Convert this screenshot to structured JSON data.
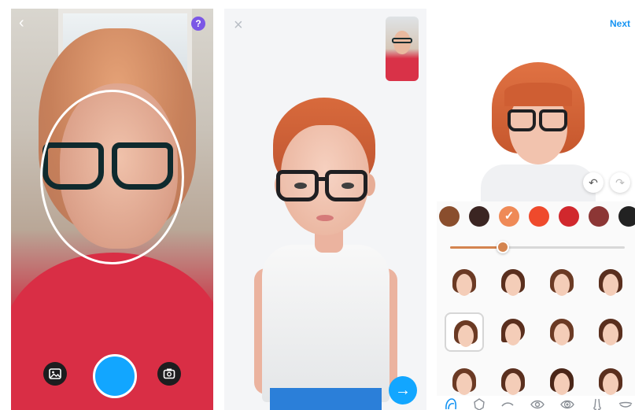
{
  "camera": {
    "back_icon": "chevron-left-icon",
    "help_label": "?",
    "gallery_icon": "gallery-icon",
    "capture_button": "capture-button",
    "flip_icon": "camera-flip-icon"
  },
  "avatar_preview": {
    "close_icon": "close-icon",
    "thumbnail": "photo-thumbnail",
    "next_arrow_label": "→"
  },
  "editor": {
    "next_label": "Next",
    "undo_icon": "undo-icon",
    "redo_icon": "redo-icon",
    "colors": [
      {
        "hex": "#8a4e2d"
      },
      {
        "hex": "#3b2522"
      },
      {
        "hex": "#ef8a57",
        "selected": true
      },
      {
        "hex": "#ef4a2c"
      },
      {
        "hex": "#d1282d"
      },
      {
        "hex": "#8c3635"
      },
      {
        "hex": "#222222"
      }
    ],
    "check_mark": "✓",
    "slider": {
      "value": 0.3
    },
    "tabs": [
      "hair-icon",
      "face-shape-icon",
      "eyebrow-icon",
      "eye-icon",
      "eye-color-icon",
      "nose-icon",
      "mouth-icon"
    ]
  }
}
